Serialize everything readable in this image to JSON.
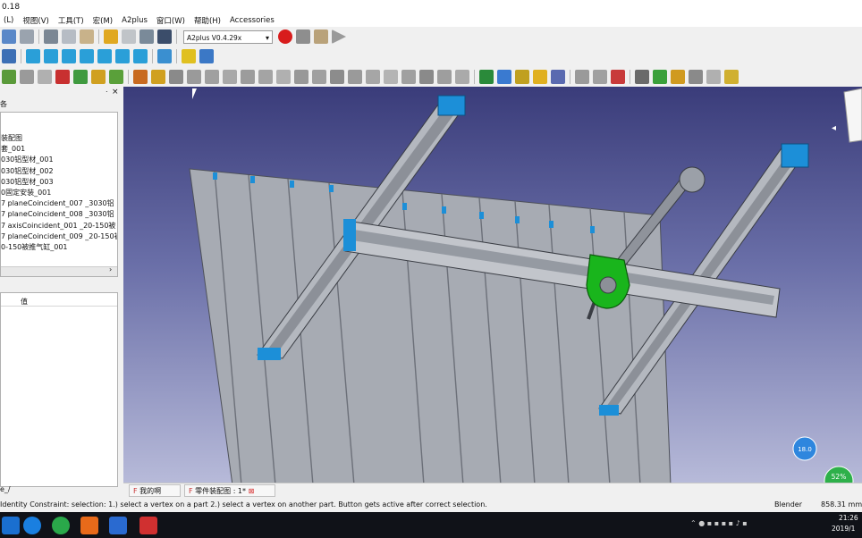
{
  "window": {
    "title": "0.18"
  },
  "menu": [
    "(L)",
    "视图(V)",
    "工具(T)",
    "宏(M)",
    "A2plus",
    "窗口(W)",
    "帮助(H)",
    "Accessories"
  ],
  "workbench_selector": {
    "value": "A2plus V0.4.29x"
  },
  "panel": {
    "tree_header": "各",
    "tree_items": [
      "装配图",
      "套_001",
      "030铝型材_001",
      "030铝型材_002",
      "030铝型材_003",
      "0固定安装_001",
      "7  planeCoincident_007  _3030铝",
      "7  planeCoincident_008  _3030铝",
      "7  axisCoincident_001  _20-150被",
      "7  planeCoincident_009  _20-150被",
      "0-150被推气缸_001"
    ],
    "property_col": "值",
    "bottom_label": "e_/"
  },
  "doc_tabs": [
    "我的啊",
    "零件装配图 : 1*"
  ],
  "statusbar": {
    "message": "Identity Constraint: selection: 1.) select a vertex on a part 2.) select a vertex on another part. Button gets active after correct selection.",
    "nav_style": "Blender",
    "dimension": "858.31 mm"
  },
  "viewport": {
    "fps_badge": "18.0",
    "cpu_badge": "52%"
  },
  "taskbar": {
    "time": "21:26",
    "date": "2019/1"
  },
  "colors": {
    "toolbar_bg": "#f0f0f0",
    "viewport_top": "#3a3c7a",
    "viewport_bottom": "#b7bad9",
    "accent_green": "#2eb04a",
    "part_green": "#19b51c",
    "rail_blue": "#1c8fd8"
  }
}
